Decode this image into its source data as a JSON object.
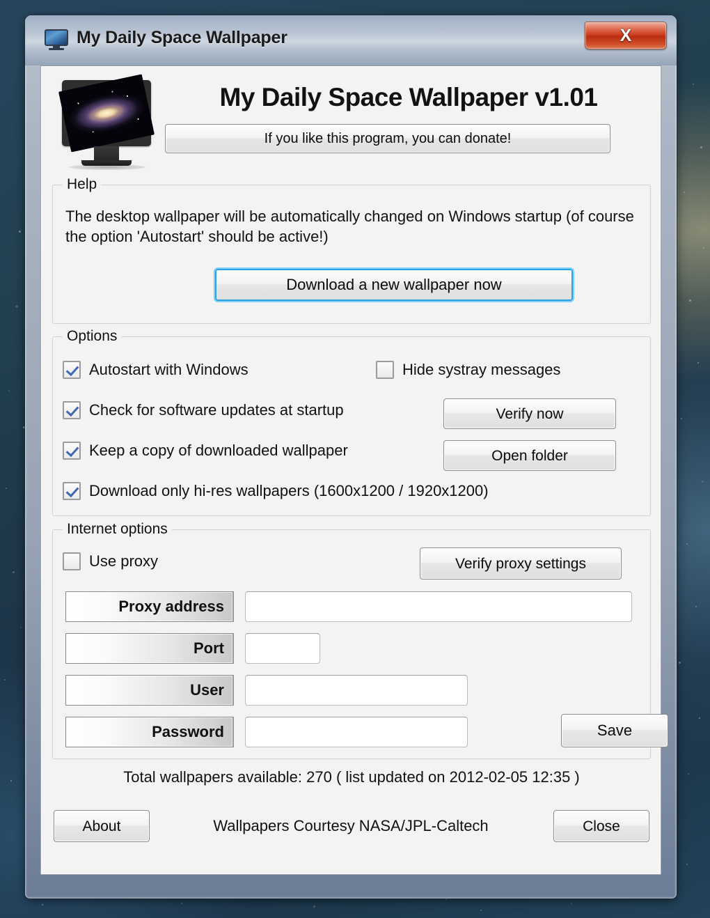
{
  "window": {
    "title": "My Daily Space Wallpaper",
    "titlebar_icon": "monitor-icon",
    "close_label": "X"
  },
  "header": {
    "app_title": "My Daily Space Wallpaper v1.01",
    "logo_icon": "galaxy-monitor-icon",
    "donate_label": "If you like this program, you can donate!"
  },
  "help": {
    "group_title": "Help",
    "text": "The desktop wallpaper will be automatically changed on Windows startup (of course the option 'Autostart' should be active!)",
    "download_label": "Download a new wallpaper now"
  },
  "options": {
    "group_title": "Options",
    "items": [
      {
        "label": "Autostart with Windows",
        "checked": true
      },
      {
        "label": "Hide systray messages",
        "checked": false
      },
      {
        "label": "Check for software updates at startup",
        "checked": true
      },
      {
        "label": "Keep a copy of downloaded wallpaper",
        "checked": true
      },
      {
        "label": "Download only hi-res wallpapers (1600x1200 / 1920x1200)",
        "checked": true
      }
    ],
    "verify_now_label": "Verify now",
    "open_folder_label": "Open folder"
  },
  "internet": {
    "group_title": "Internet options",
    "use_proxy_label": "Use proxy",
    "use_proxy_checked": false,
    "verify_proxy_label": "Verify proxy settings",
    "fields": [
      {
        "label": "Proxy address",
        "value": "",
        "placeholder": ""
      },
      {
        "label": "Port",
        "value": "",
        "placeholder": ""
      },
      {
        "label": "User",
        "value": "",
        "placeholder": ""
      },
      {
        "label": "Password",
        "value": "",
        "placeholder": ""
      }
    ],
    "save_label": "Save"
  },
  "footer": {
    "status": "Total wallpapers available: 270 ( list updated on 2012-02-05 12:35 )",
    "about_label": "About",
    "credit": "Wallpapers Courtesy NASA/JPL-Caltech",
    "close_label": "Close"
  },
  "colors": {
    "accent_focus": "#2ba3e0",
    "checkmark": "#3d68b0",
    "close_red": "#cc3b1e",
    "client_bg": "#f3f3f3"
  }
}
